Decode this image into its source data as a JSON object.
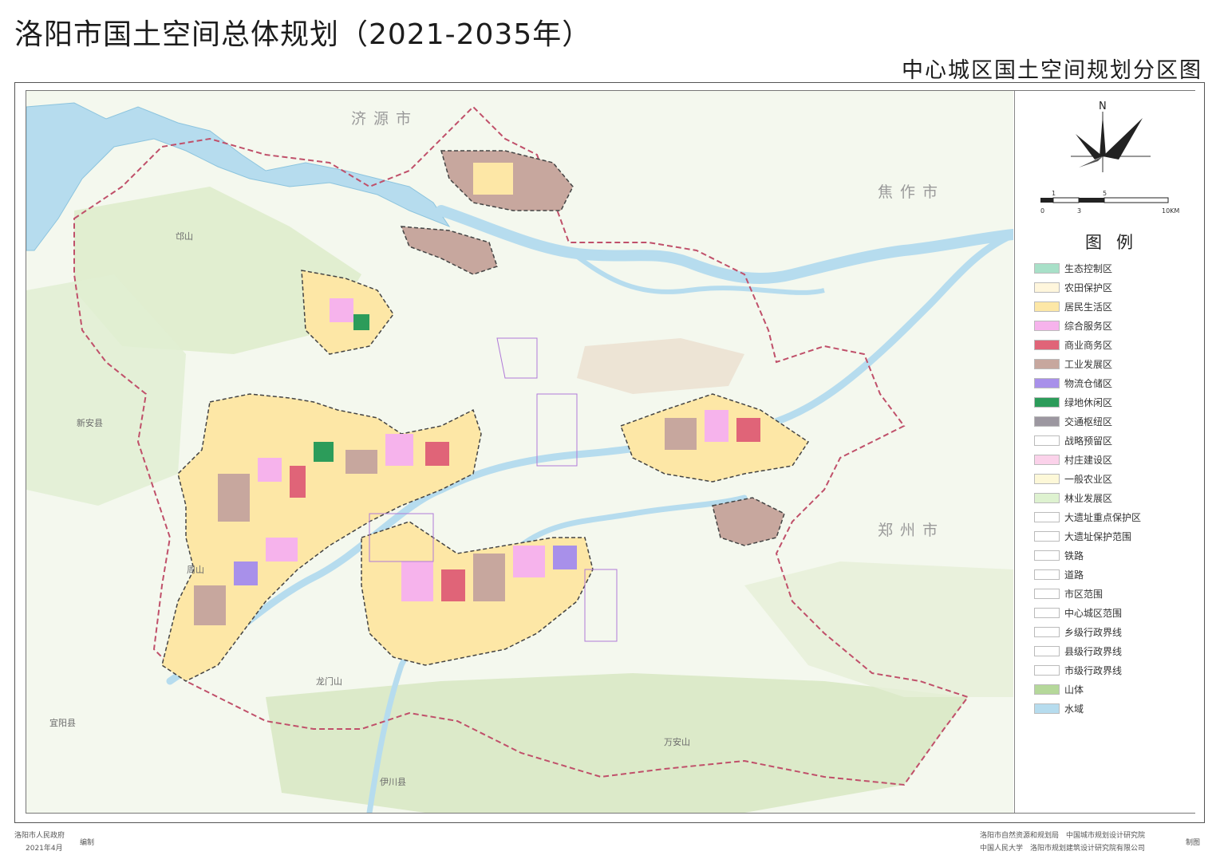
{
  "title": "洛阳市国土空间总体规划（2021-2035年）",
  "subtitle": "中心城区国土空间规划分区图",
  "legend": {
    "title": "图例",
    "items": [
      {
        "label": "生态控制区",
        "color": "#a8e0c8"
      },
      {
        "label": "农田保护区",
        "color": "#fff6dc"
      },
      {
        "label": "居民生活区",
        "color": "#fde7a6"
      },
      {
        "label": "综合服务区",
        "color": "#f6b3ec"
      },
      {
        "label": "商业商务区",
        "color": "#e06478"
      },
      {
        "label": "工业发展区",
        "color": "#c7a79e"
      },
      {
        "label": "物流仓储区",
        "color": "#a890ea"
      },
      {
        "label": "绿地休闲区",
        "color": "#2c9c5a"
      },
      {
        "label": "交通枢纽区",
        "color": "#9c97a0"
      },
      {
        "label": "战略预留区",
        "color": "#ffffff"
      },
      {
        "label": "村庄建设区",
        "color": "#fbd2ea"
      },
      {
        "label": "一般农业区",
        "color": "#fdf8d8"
      },
      {
        "label": "林业发展区",
        "color": "#def2d0"
      },
      {
        "label": "大遗址重点保护区",
        "color": "#ffffff"
      },
      {
        "label": "大遗址保护范围",
        "color": "#ffffff"
      },
      {
        "label": "铁路",
        "color": "#ffffff"
      },
      {
        "label": "道路",
        "color": "#ffffff"
      },
      {
        "label": "市区范围",
        "color": "#ffffff"
      },
      {
        "label": "中心城区范围",
        "color": "#ffffff"
      },
      {
        "label": "乡级行政界线",
        "color": "#ffffff"
      },
      {
        "label": "县级行政界线",
        "color": "#ffffff"
      },
      {
        "label": "市级行政界线",
        "color": "#ffffff"
      },
      {
        "label": "山体",
        "color": "#b5d89a"
      },
      {
        "label": "水域",
        "color": "#b6dcee"
      }
    ]
  },
  "compass": {
    "north": "N"
  },
  "scale": {
    "marks": [
      "0",
      "1",
      "3",
      "5",
      "10KM"
    ]
  },
  "map": {
    "cities": [
      "济源市",
      "焦作市",
      "郑州市"
    ],
    "counties": [
      "新安县",
      "宜阳县",
      "伊川县"
    ],
    "mountains": [
      "邙山",
      "周山",
      "龙门山",
      "万安山"
    ]
  },
  "footer": {
    "left_org": "洛阳市人民政府",
    "left_date": "2021年4月",
    "left_action": "编制",
    "right_line1": "洛阳市自然资源和规划局　中国城市规划设计研究院",
    "right_line2": "中国人民大学　洛阳市规划建筑设计研究院有限公司",
    "right_action": "制图"
  },
  "colors": {
    "frame": "#555555",
    "boundary_city": "#c0506a",
    "boundary_center": "#555555",
    "water": "#b6dcee",
    "background_green": "#e8f2dc"
  }
}
